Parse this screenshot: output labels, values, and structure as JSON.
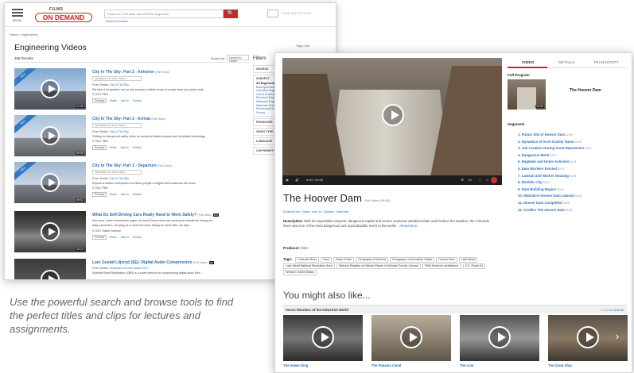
{
  "back_window": {
    "menu_label": "MENU",
    "logo_top": "FILMS",
    "logo_main": "ON DEMAND",
    "search_placeholder": "Search 51,000 titles and 398,000 segments",
    "search_button": "🔍",
    "advanced_search": "Advanced Search",
    "institution": "YOUR INSTITUTION",
    "breadcrumb_home": "Home",
    "breadcrumb_sep": " › ",
    "breadcrumb_current": "Engineering",
    "page_title": "Engineering Videos",
    "tags_link": "Tags Link",
    "results_count": "356 Results",
    "sorted_by": "Sorted by:",
    "sort_value": "Newest to Oldest",
    "results": [
      {
        "title": "City In The Sky: Part 2 - Airborne",
        "qualifier": "(Full Video)",
        "segments": "SEGMENTS IN THIS VIDEO",
        "series_label": "From Series:",
        "series": "City In The Sky",
        "desc": "We take it for granted, but on any journey a hidden army of people keep your plane safe.",
        "year": "© 2017 PBS",
        "preview": "Preview",
        "actions": [
          "Share",
          "Add to",
          "Embed"
        ],
        "duration": "01:00",
        "ribbon": "NEW"
      },
      {
        "title": "City In The Sky: Part 3 - Arrival",
        "qualifier": "(Full Video)",
        "segments": "SEGMENTS IN THIS VIDEO",
        "series_label": "From Series:",
        "series": "City In The Sky",
        "desc": "Getting on the ground safely relies on armies of hidden experts and incredible technology.",
        "year": "© 2017 PBS",
        "preview": "Preview",
        "actions": [
          "Share",
          "Add to",
          "Embed"
        ],
        "duration": "59:59",
        "ribbon": "NEW"
      },
      {
        "title": "City In The Sky: Part 1 - Departure",
        "qualifier": "(Full Video)",
        "segments": "SEGMENTS IN THIS VIDEO",
        "series_label": "From Series:",
        "series": "City In The Sky",
        "desc": "Explore a hidden metropolis of a million people on flights that crisscross the world.",
        "year": "© 2017 PBS",
        "preview": "Preview",
        "actions": [
          "Share",
          "Add to",
          "Embed"
        ],
        "duration": "59:57",
        "ribbon": "NEW"
      },
      {
        "title": "What Do Self-Driving Cars Really Need to Work Safely?",
        "qualifier": "(Full Video)",
        "badge": "CC",
        "desc1": "And soon, some researchers argue, we would have robot cars serving as chauffeurs during our",
        "desc2": "daily commutes—ferrying us to and from work, taking us home after our trips...",
        "year": "© 2017 Inside Science",
        "preview": "Preview",
        "actions": [
          "Share",
          "Add to",
          "Embed"
        ],
        "duration": "03:21"
      },
      {
        "title": "Lars Gustaf Liljeryd (SE): Digital Audio Compression",
        "qualifier": "(Full Video)",
        "badge": "CC",
        "series_label": "From Series:",
        "series": "European Inventor Award 2017",
        "desc": "Spectral Band Replication (SBR) is a novel method for compressing digital audio files...",
        "duration": "04:00"
      }
    ],
    "filters_title": "Filters",
    "filter_groups": [
      {
        "name": "SOURCE",
        "items": []
      },
      {
        "name": "SUBJECT",
        "items": [
          "All Engineering",
          "Bioengineering",
          "Chemical Engineering",
          "Civil & Environmental",
          "Electrical Engineering",
          "Industrial Engineering",
          "Materials Science",
          "Mechanical & Aerospace",
          "Survey"
        ]
      },
      {
        "name": "PRODUCER",
        "items": []
      },
      {
        "name": "VIDEO TYPE",
        "items": []
      },
      {
        "name": "LANGUAGE",
        "items": []
      },
      {
        "name": "COPYRIGHT DATE",
        "items": []
      }
    ]
  },
  "caption": "Use the powerful search and browse tools to find the perfect titles and clips for lectures and assignments.",
  "front_window": {
    "player": {
      "time": "0:00 / 49:50",
      "speed": "1x",
      "cc": "CC"
    },
    "video_title": "The Hoover Dam",
    "video_qualifier": "Full Video (49:50)",
    "video_actions": "Embed/Link  Share  Add to  Citation  Segment",
    "description_label": "Description:",
    "description": "With its impossible canyons, dangerous rapids and severe seasonal variations that could induce the weather, the Colorado River was one of the most dangerous and unpredictable rivers in the world.",
    "read_more": "...Read More",
    "producer_label": "Producer:",
    "producer": "BBC",
    "tags_label": "Tags:",
    "tags": [
      "Colorado River",
      "Dam",
      "Frank Crowe",
      "Geography of Arizona",
      "Geography of the United States",
      "Hoover Dam",
      "Lake Mead",
      "Lake Mead National Recreation Area",
      "National Register of Historic Places in Mohave County, Arizona",
      "PWA Moderne architecture",
      "U.S. Route 93",
      "Western United States"
    ],
    "you_might_like": "You might also like...",
    "row_title": "Seven Wonders of the Industrial World",
    "row_count": "1-4 of 6",
    "view_all": "View All",
    "cards": [
      "The Sewer King",
      "The Panama Canal",
      "The Line",
      "The Great Ship"
    ],
    "tabs": [
      "VIDEO",
      "DETAILS",
      "TRANSCRIPT"
    ],
    "full_program_label": "Full Program",
    "full_program_title": "The Hoover Dam",
    "full_program_duration": "49:50",
    "segments_label": "Segments",
    "segments": [
      {
        "n": "1.",
        "title": "Future Site of Hoover Dam",
        "dur": "02:46"
      },
      {
        "n": "2.",
        "title": "Dynamics of Arch-Gravity Dams",
        "dur": "03:28"
      },
      {
        "n": "3.",
        "title": "Job Creation During Great Depression",
        "dur": "03:20"
      },
      {
        "n": "4.",
        "title": "Dangerous Work",
        "dur": "03:27"
      },
      {
        "n": "5.",
        "title": "Ragtown and Union Activism",
        "dur": "04:31"
      },
      {
        "n": "6.",
        "title": "Dam Workers Evicted",
        "dur": "02:11"
      },
      {
        "n": "7.",
        "title": "Lawsuit and Worker Housing",
        "dur": "04:51"
      },
      {
        "n": "8.",
        "title": "Boulder City",
        "dur": "04:01"
      },
      {
        "n": "9.",
        "title": "Dam Building Begins",
        "dur": "06:00"
      },
      {
        "n": "10.",
        "title": "Mistrial in Hoover Dam Lawsuit",
        "dur": "03:20"
      },
      {
        "n": "11.",
        "title": "Hoover Dam Completed",
        "dur": "06:38"
      },
      {
        "n": "12.",
        "title": "Credits: The Hoover Dam",
        "dur": "00:33"
      }
    ]
  }
}
